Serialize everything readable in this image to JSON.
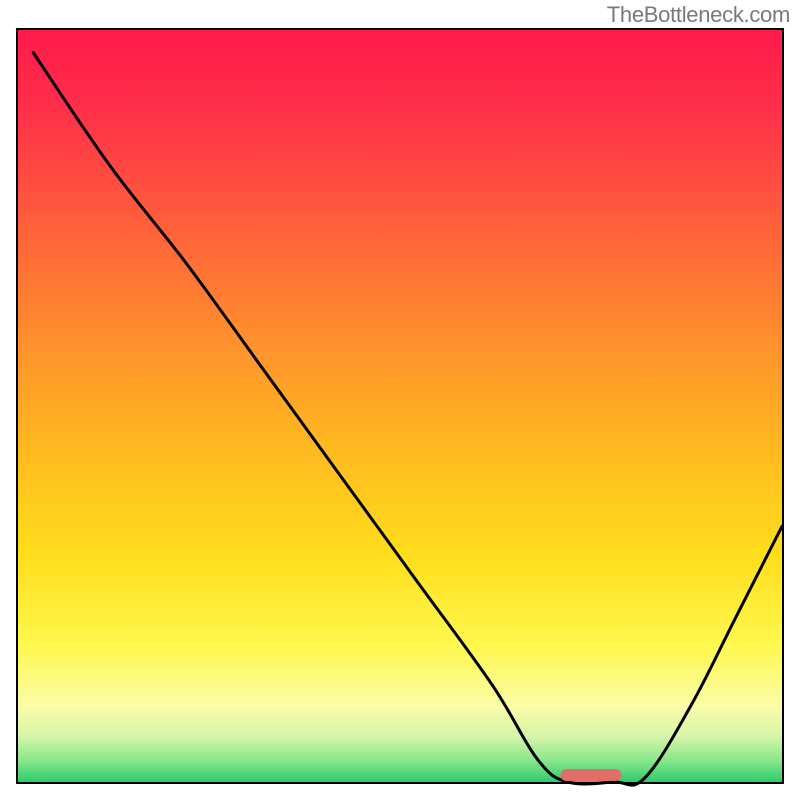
{
  "watermark": "TheBottleneck.com",
  "chart_data": {
    "type": "line",
    "title": "",
    "xlabel": "",
    "ylabel": "",
    "xlim": [
      0,
      100
    ],
    "ylim": [
      0,
      100
    ],
    "x": [
      2,
      12,
      22,
      32,
      42,
      52,
      62,
      68,
      72,
      78,
      82,
      88,
      94,
      100
    ],
    "values": [
      97,
      82,
      69,
      55,
      41,
      27,
      13,
      3,
      0,
      0,
      0.5,
      10,
      22,
      34
    ],
    "marker": {
      "x_range": [
        71,
        79
      ],
      "y": 0,
      "color": "#E26E6A"
    },
    "axes": {
      "show_ticks": false,
      "show_labels": false,
      "border_width": 2,
      "border_color": "#000000"
    },
    "background_gradient": {
      "type": "vertical",
      "stops": [
        {
          "pos": 0.0,
          "color": "#FF1A4A"
        },
        {
          "pos": 0.1,
          "color": "#FF2E4A"
        },
        {
          "pos": 0.25,
          "color": "#FF5C3C"
        },
        {
          "pos": 0.4,
          "color": "#FF8C2E"
        },
        {
          "pos": 0.55,
          "color": "#FFB820"
        },
        {
          "pos": 0.7,
          "color": "#FFDE1C"
        },
        {
          "pos": 0.82,
          "color": "#FFF850"
        },
        {
          "pos": 0.9,
          "color": "#FAFCA8"
        },
        {
          "pos": 0.94,
          "color": "#D4F5A8"
        },
        {
          "pos": 0.97,
          "color": "#8CE78C"
        },
        {
          "pos": 1.0,
          "color": "#2ECB6E"
        }
      ]
    },
    "line": {
      "color": "#000000",
      "width": 3
    }
  }
}
